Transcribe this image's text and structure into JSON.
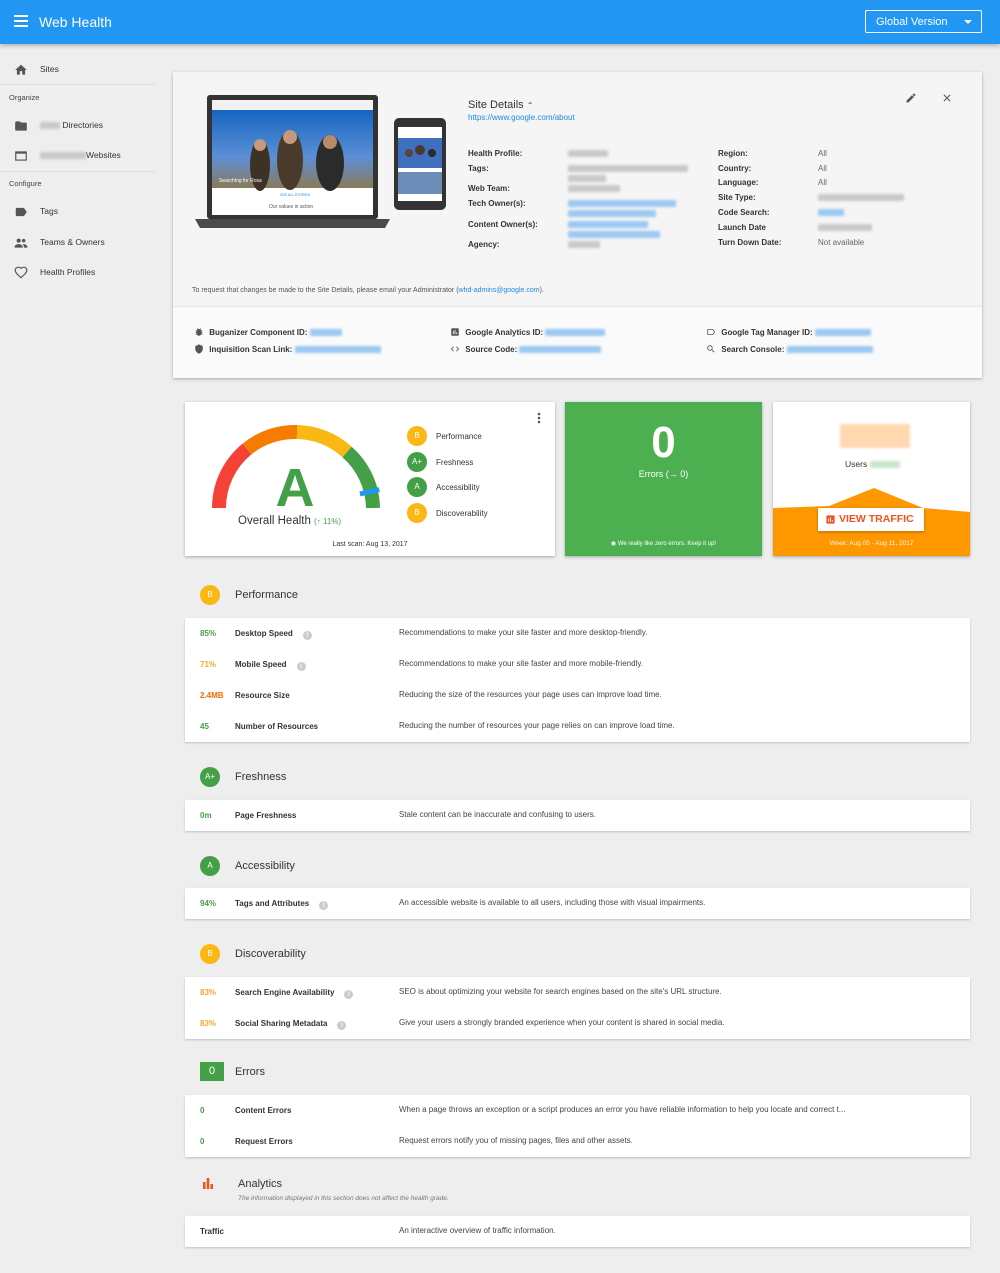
{
  "app": {
    "title": "Web Health",
    "version_button": "Global Version"
  },
  "sidebar": {
    "sites": "Sites",
    "organize_header": "Organize",
    "directories": "Directories",
    "websites": "Websites",
    "configure_header": "Configure",
    "tags": "Tags",
    "teams_owners": "Teams & Owners",
    "health_profiles": "Health Profiles"
  },
  "site_details": {
    "title": "Site Details",
    "url": "https://www.google.com/about",
    "left_labels": {
      "health_profile": "Health Profile:",
      "tags": "Tags:",
      "web_team": "Web Team:",
      "tech_owners": "Tech Owner(s):",
      "content_owners": "Content Owner(s):",
      "agency": "Agency:"
    },
    "right_labels": {
      "region": "Region:",
      "country": "Country:",
      "language": "Language:",
      "site_type": "Site Type:",
      "code_search": "Code Search:",
      "launch_date": "Launch Date",
      "turn_down_date": "Turn Down Date:"
    },
    "right_values": {
      "region": "All",
      "country": "All",
      "language": "All",
      "turn_down_date": "Not available"
    },
    "note_prefix": "To request that changes be made to the Site Details, please email your Administrator (",
    "note_email": "whd-admins@google.com",
    "note_suffix": ").",
    "ids": {
      "buganizer": "Buganizer Component ID:",
      "inquisition": "Inquisition Scan Link:",
      "analytics": "Google Analytics ID:",
      "source_code": "Source Code:",
      "gtm": "Google Tag Manager ID:",
      "search_console": "Search Console:"
    },
    "preview": {
      "laptop_caption": "Searching for Rosa",
      "laptop_link": "SEE ALL STORIES",
      "laptop_footer": "Our values in action"
    }
  },
  "health": {
    "grade": "A",
    "label": "Overall Health",
    "delta": "11%",
    "last_scan": "Last scan: Aug 13, 2017",
    "gauge_level_pct": 92,
    "categories": [
      {
        "grade": "B",
        "name": "Performance"
      },
      {
        "grade": "A+",
        "name": "Freshness"
      },
      {
        "grade": "A",
        "name": "Accessibility"
      },
      {
        "grade": "B",
        "name": "Discoverability"
      }
    ]
  },
  "errors_card": {
    "count": "0",
    "label": "Errors",
    "change": "0",
    "footer": "We really like zero errors. Keep it up!"
  },
  "traffic_card": {
    "users_label": "Users",
    "button": "VIEW TRAFFIC",
    "week": "Week: Aug 05 - Aug 11, 2017"
  },
  "sections": {
    "performance": {
      "grade": "B",
      "title": "Performance",
      "rows": [
        {
          "value": "85%",
          "name": "Desktop Speed",
          "desc": "Recommendations to make your site faster and more desktop-friendly."
        },
        {
          "value": "71%",
          "name": "Mobile Speed",
          "desc": "Recommendations to make your site faster and more mobile-friendly."
        },
        {
          "value": "2.4MB",
          "name": "Resource Size",
          "desc": "Reducing the size of the resources your page uses can improve load time."
        },
        {
          "value": "45",
          "name": "Number of Resources",
          "desc": "Reducing the number of resources your page relies on can improve load time."
        }
      ]
    },
    "freshness": {
      "grade": "A+",
      "title": "Freshness",
      "rows": [
        {
          "value": "0m",
          "name": "Page Freshness",
          "desc": "Stale content can be inaccurate and confusing to users."
        }
      ]
    },
    "accessibility": {
      "grade": "A",
      "title": "Accessibility",
      "rows": [
        {
          "value": "94%",
          "name": "Tags and Attributes",
          "desc": "An accessible website is available to all users, including those with visual impairments."
        }
      ]
    },
    "discoverability": {
      "grade": "B",
      "title": "Discoverability",
      "rows": [
        {
          "value": "83%",
          "name": "Search Engine Availability",
          "desc": "SEO is about optimizing your website for search engines based on the site's URL structure."
        },
        {
          "value": "83%",
          "name": "Social Sharing Metadata",
          "desc": "Give your users a strongly branded experience when your content is shared in social media."
        }
      ]
    },
    "errors": {
      "count": "0",
      "title": "Errors",
      "rows": [
        {
          "value": "0",
          "name": "Content Errors",
          "desc": "When a page throws an exception or a script produces an error you have reliable information to help you locate and correct t..."
        },
        {
          "value": "0",
          "name": "Request Errors",
          "desc": "Request errors notify you of missing pages, files and other assets."
        }
      ]
    },
    "analytics": {
      "title": "Analytics",
      "subtitle": "The information displayed in this section does not affect the health grade.",
      "rows": [
        {
          "name": "Traffic",
          "desc": "An interactive overview of traffic information."
        }
      ]
    }
  },
  "colors": {
    "primary": "#2196f3",
    "green": "#43a047",
    "yellow": "#fbb714",
    "orange": "#ff9800",
    "red": "#f44336"
  }
}
